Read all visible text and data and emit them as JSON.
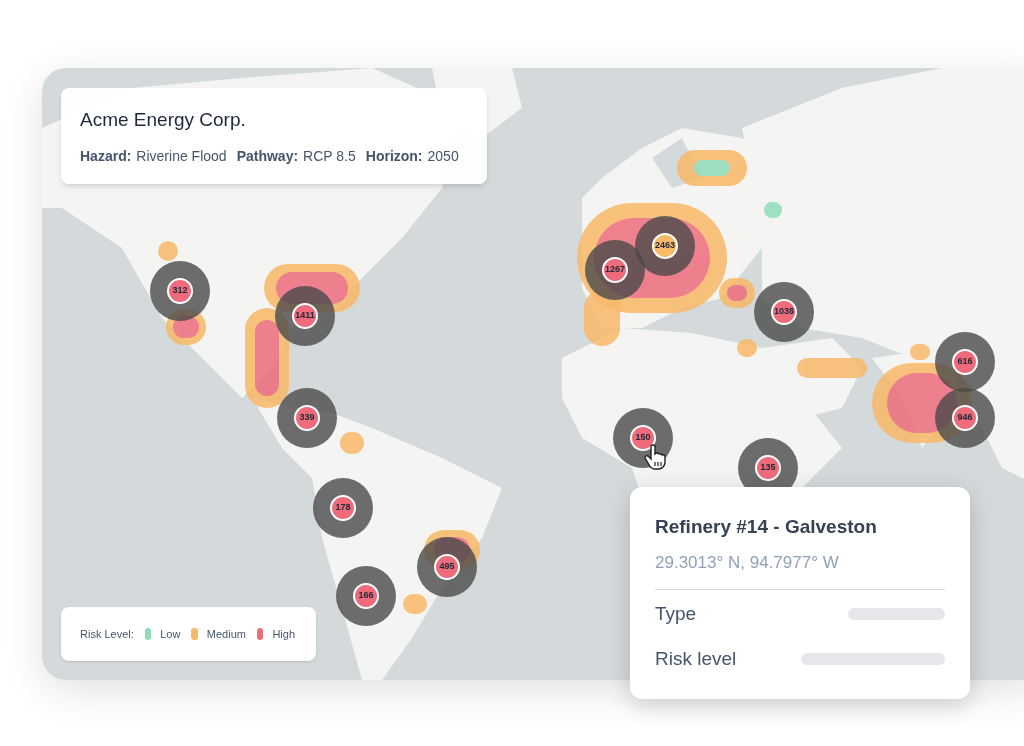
{
  "header": {
    "company": "Acme Energy Corp.",
    "fields": [
      {
        "label": "Hazard:",
        "value": "Riverine Flood"
      },
      {
        "label": "Pathway:",
        "value": "RCP 8.5"
      },
      {
        "label": "Horizon:",
        "value": "2050"
      }
    ]
  },
  "clusters": [
    {
      "count": "312",
      "color": "#ee6b7b"
    },
    {
      "count": "1411",
      "color": "#ee6b7b"
    },
    {
      "count": "339",
      "color": "#ee6b7b"
    },
    {
      "count": "178",
      "color": "#ee6b7b"
    },
    {
      "count": "495",
      "color": "#ee6b7b"
    },
    {
      "count": "166",
      "color": "#ee6b7b"
    },
    {
      "count": "1267",
      "color": "#ee6b7b"
    },
    {
      "count": "2463",
      "color": "#f8b968"
    },
    {
      "count": "1038",
      "color": "#ee6b7b"
    },
    {
      "count": "616",
      "color": "#ee6b7b"
    },
    {
      "count": "946",
      "color": "#ee6b7b"
    },
    {
      "count": "150",
      "color": "#ee6b7b"
    },
    {
      "count": "135",
      "color": "#ee6b7b"
    }
  ],
  "legend": {
    "title": "Risk Level:",
    "items": [
      {
        "label": "Low",
        "color": "#8fdcb8"
      },
      {
        "label": "Medium",
        "color": "#f8b968"
      },
      {
        "label": "High",
        "color": "#ee6b7b"
      }
    ]
  },
  "popup": {
    "title": "Refinery #14 - Galveston",
    "coordinates": "29.3013° N, 94.7977° W",
    "rows": [
      {
        "label": "Type"
      },
      {
        "label": "Risk level"
      }
    ]
  }
}
